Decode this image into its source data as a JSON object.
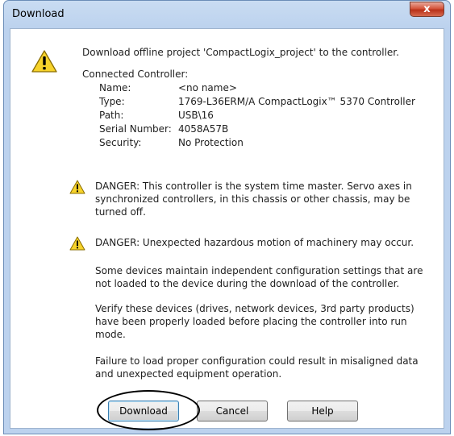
{
  "window": {
    "title": "Download",
    "close_label": "x"
  },
  "header": {
    "message": "Download offline project 'CompactLogix_project' to the controller."
  },
  "controller": {
    "heading": "Connected Controller:",
    "rows": [
      {
        "key": "Name:",
        "value": "<no name>"
      },
      {
        "key": "Type:",
        "value": "1769-L36ERM/A CompactLogix™ 5370 Controller"
      },
      {
        "key": "Path:",
        "value": "USB\\16"
      },
      {
        "key": "Serial Number:",
        "value": "4058A57B"
      },
      {
        "key": "Security:",
        "value": "No Protection"
      }
    ]
  },
  "warnings": {
    "danger1": [
      "DANGER: This controller is the system time master.  Servo axes in",
      "synchronized controllers, in this chassis or other chassis, may be",
      "turned off."
    ],
    "danger2": "DANGER: Unexpected hazardous motion of machinery may occur.",
    "para1": [
      "Some devices maintain independent configuration settings that are",
      "not loaded to the device during the download of the controller."
    ],
    "para2": [
      "Verify these devices (drives, network devices, 3rd party products)",
      "have been properly loaded before placing the controller into run",
      "mode."
    ],
    "para3": [
      "Failure to load proper configuration could result in misaligned data",
      "and unexpected equipment operation."
    ]
  },
  "buttons": {
    "download": "Download",
    "cancel": "Cancel",
    "help": "Help"
  },
  "colors": {
    "warning_fill": "#f7d32b",
    "warning_stroke": "#8a6d00",
    "title_bar": "#bcd2ee",
    "close_red": "#c8452a"
  }
}
